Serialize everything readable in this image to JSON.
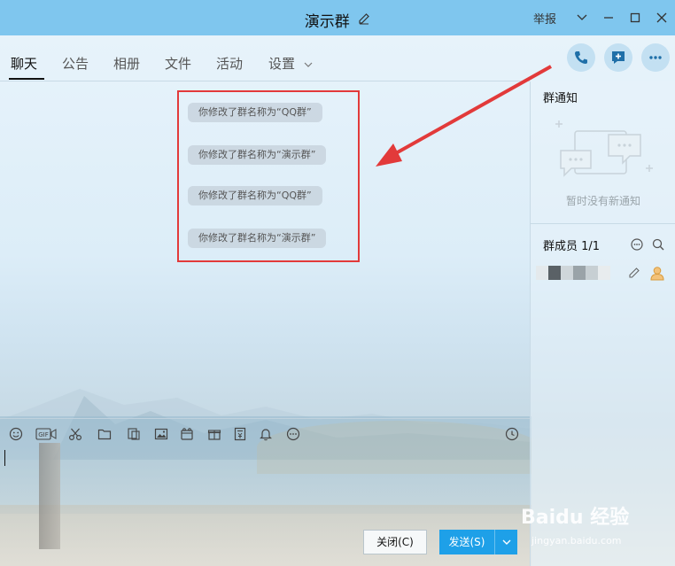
{
  "window": {
    "title": "演示群",
    "report_label": "举报"
  },
  "tabs": [
    {
      "label": "聊天"
    },
    {
      "label": "公告"
    },
    {
      "label": "相册"
    },
    {
      "label": "文件"
    },
    {
      "label": "活动"
    },
    {
      "label": "设置"
    }
  ],
  "messages": [
    {
      "text": "你修改了群名称为“QQ群”"
    },
    {
      "text": "你修改了群名称为“演示群”"
    },
    {
      "text": "你修改了群名称为“QQ群”"
    },
    {
      "text": "你修改了群名称为“演示群”"
    }
  ],
  "right_panel": {
    "notice_title": "群通知",
    "notice_empty": "暂时没有新通知",
    "members_title": "群成员 1/1"
  },
  "buttons": {
    "close": "关闭(C)",
    "send": "发送(S)"
  },
  "watermark": {
    "main": "Baidu 经验",
    "sub": "jingyan.baidu.com"
  },
  "colors": {
    "titlebar": "#7fc6ee",
    "accent": "#1ea0e8",
    "highlight_box": "#e23a3a"
  }
}
